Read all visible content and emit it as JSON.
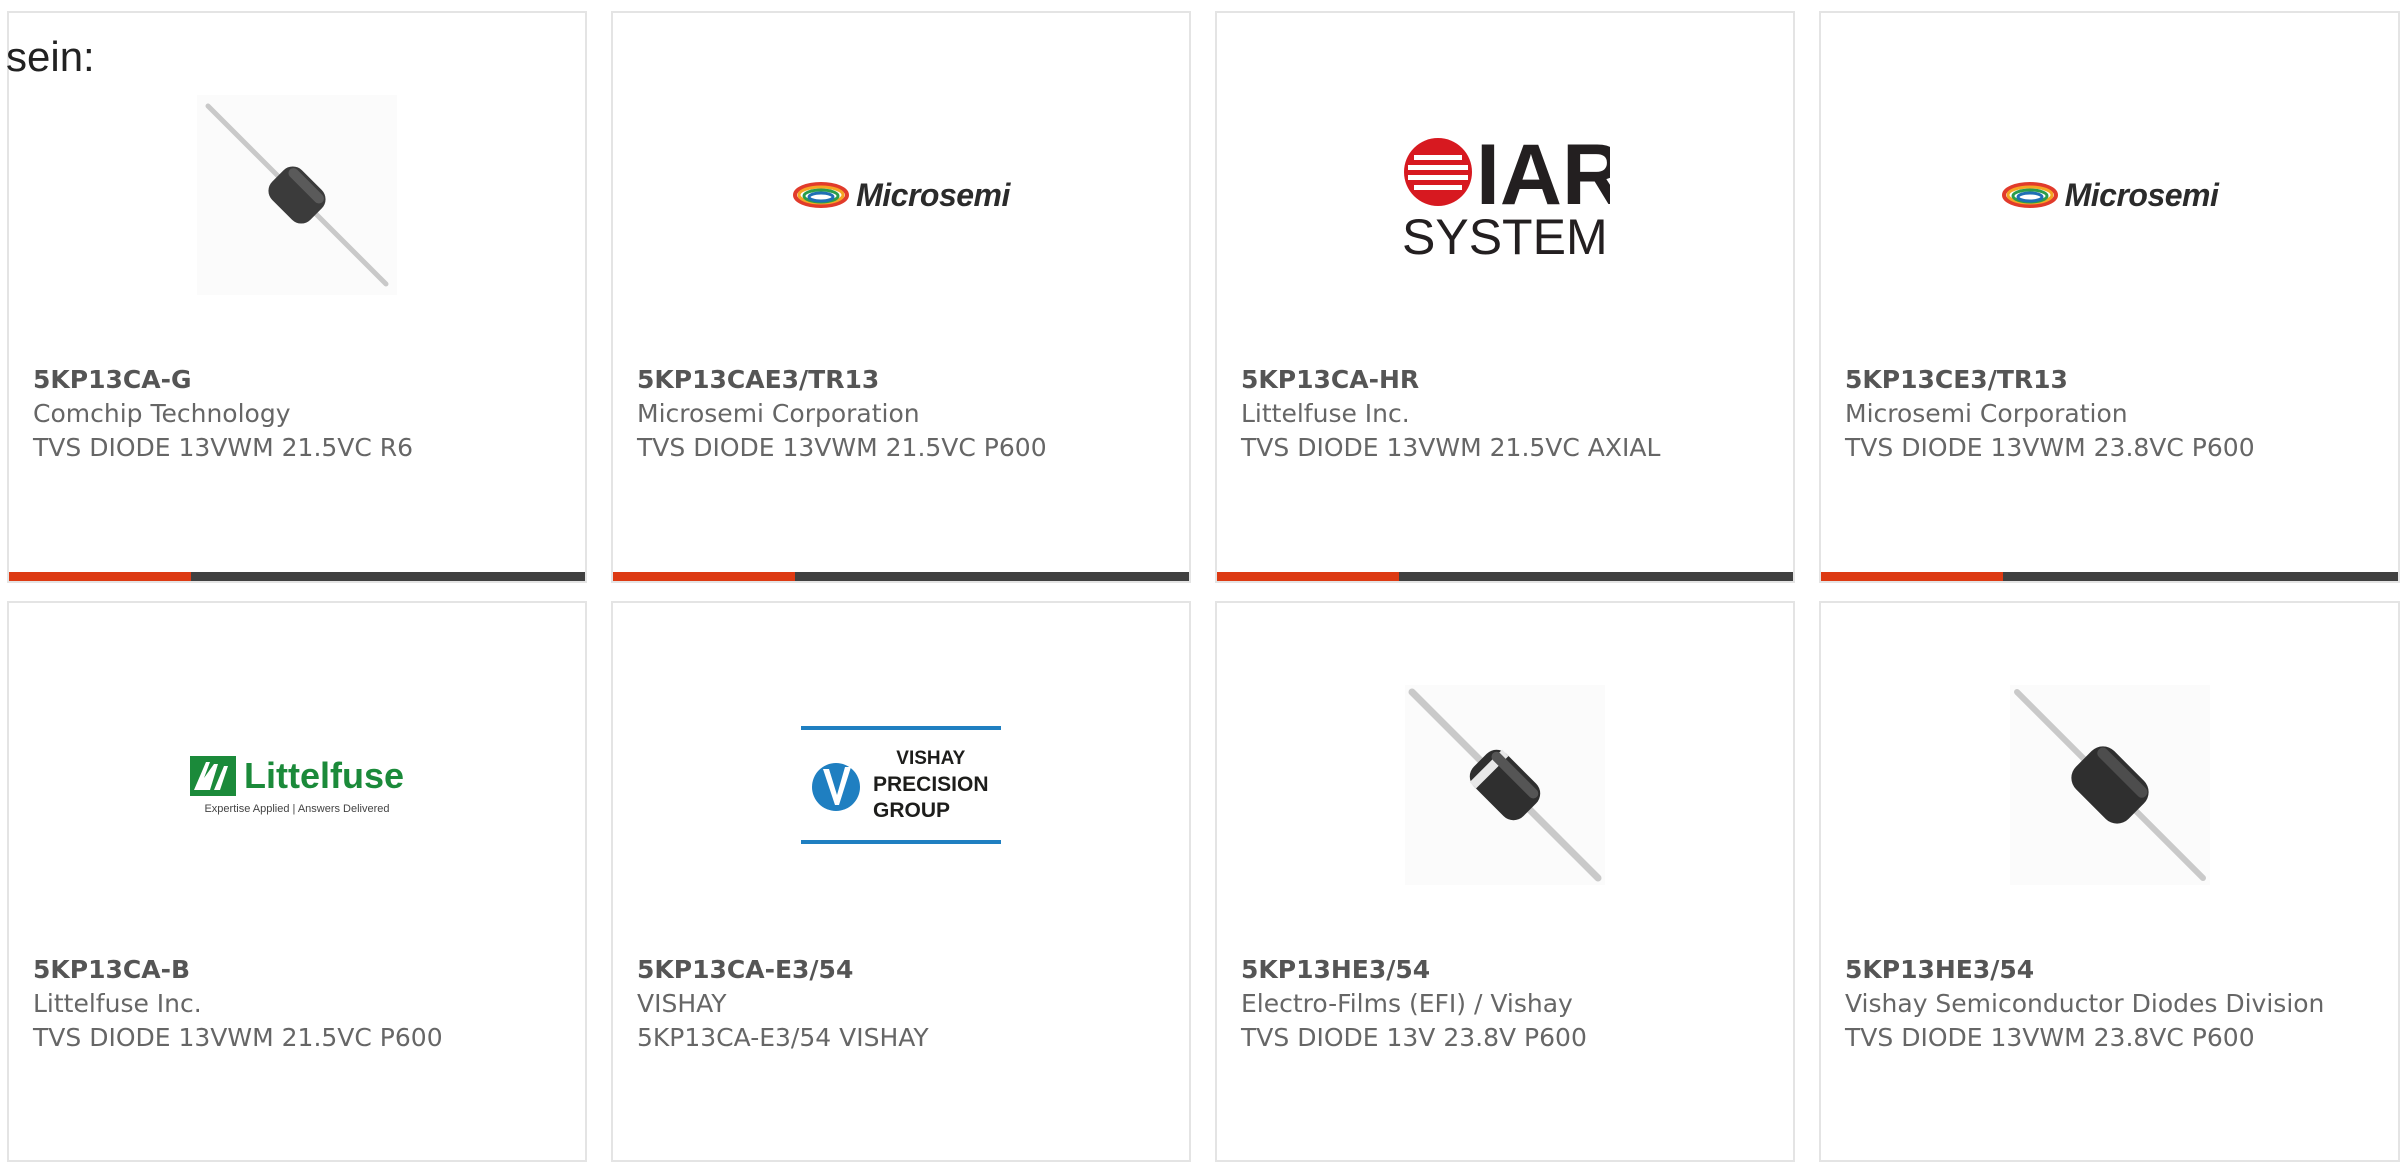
{
  "lead_text": "sein:",
  "colors": {
    "accent": "#dd3a13",
    "bar_dark": "#404040",
    "card_border": "#e4e4e4"
  },
  "products": [
    {
      "part_number": "5KP13CA-G",
      "manufacturer": "Comchip Technology",
      "description": "TVS DIODE 13VWM 21.5VC R6",
      "image": "axial-diode-image"
    },
    {
      "part_number": "5KP13CAE3/TR13",
      "manufacturer": "Microsemi Corporation",
      "description": "TVS DIODE 13VWM 21.5VC P600",
      "image": "microsemi-logo",
      "logo_text": "Microsemi"
    },
    {
      "part_number": "5KP13CA-HR",
      "manufacturer": "Littelfuse Inc.",
      "description": "TVS DIODE 13VWM 21.5VC AXIAL",
      "image": "iar-systems-logo",
      "logo_text": "IAR",
      "logo_subtext": "SYSTEMS"
    },
    {
      "part_number": "5KP13CE3/TR13",
      "manufacturer": "Microsemi Corporation",
      "description": "TVS DIODE 13VWM 23.8VC P600",
      "image": "microsemi-logo",
      "logo_text": "Microsemi"
    },
    {
      "part_number": "5KP13CA-B",
      "manufacturer": "Littelfuse Inc.",
      "description": "TVS DIODE 13VWM 21.5VC P600",
      "image": "littelfuse-logo",
      "logo_text": "Littelfuse",
      "logo_tagline": "Expertise Applied | Answers Delivered"
    },
    {
      "part_number": "5KP13CA-E3/54",
      "manufacturer": "VISHAY",
      "description": "5KP13CA-E3/54 VISHAY",
      "image": "vishay-precision-group-logo",
      "logo_lines": [
        "VISHAY",
        "PRECISION",
        "GROUP"
      ]
    },
    {
      "part_number": "5KP13HE3/54",
      "manufacturer": "Electro-Films (EFI) / Vishay",
      "description": "TVS DIODE 13V 23.8V P600",
      "image": "axial-diode-banded-image"
    },
    {
      "part_number": "5KP13HE3/54",
      "manufacturer": "Vishay Semiconductor Diodes Division",
      "description": "TVS DIODE 13VWM 23.8VC P600",
      "image": "axial-diode-image"
    }
  ]
}
